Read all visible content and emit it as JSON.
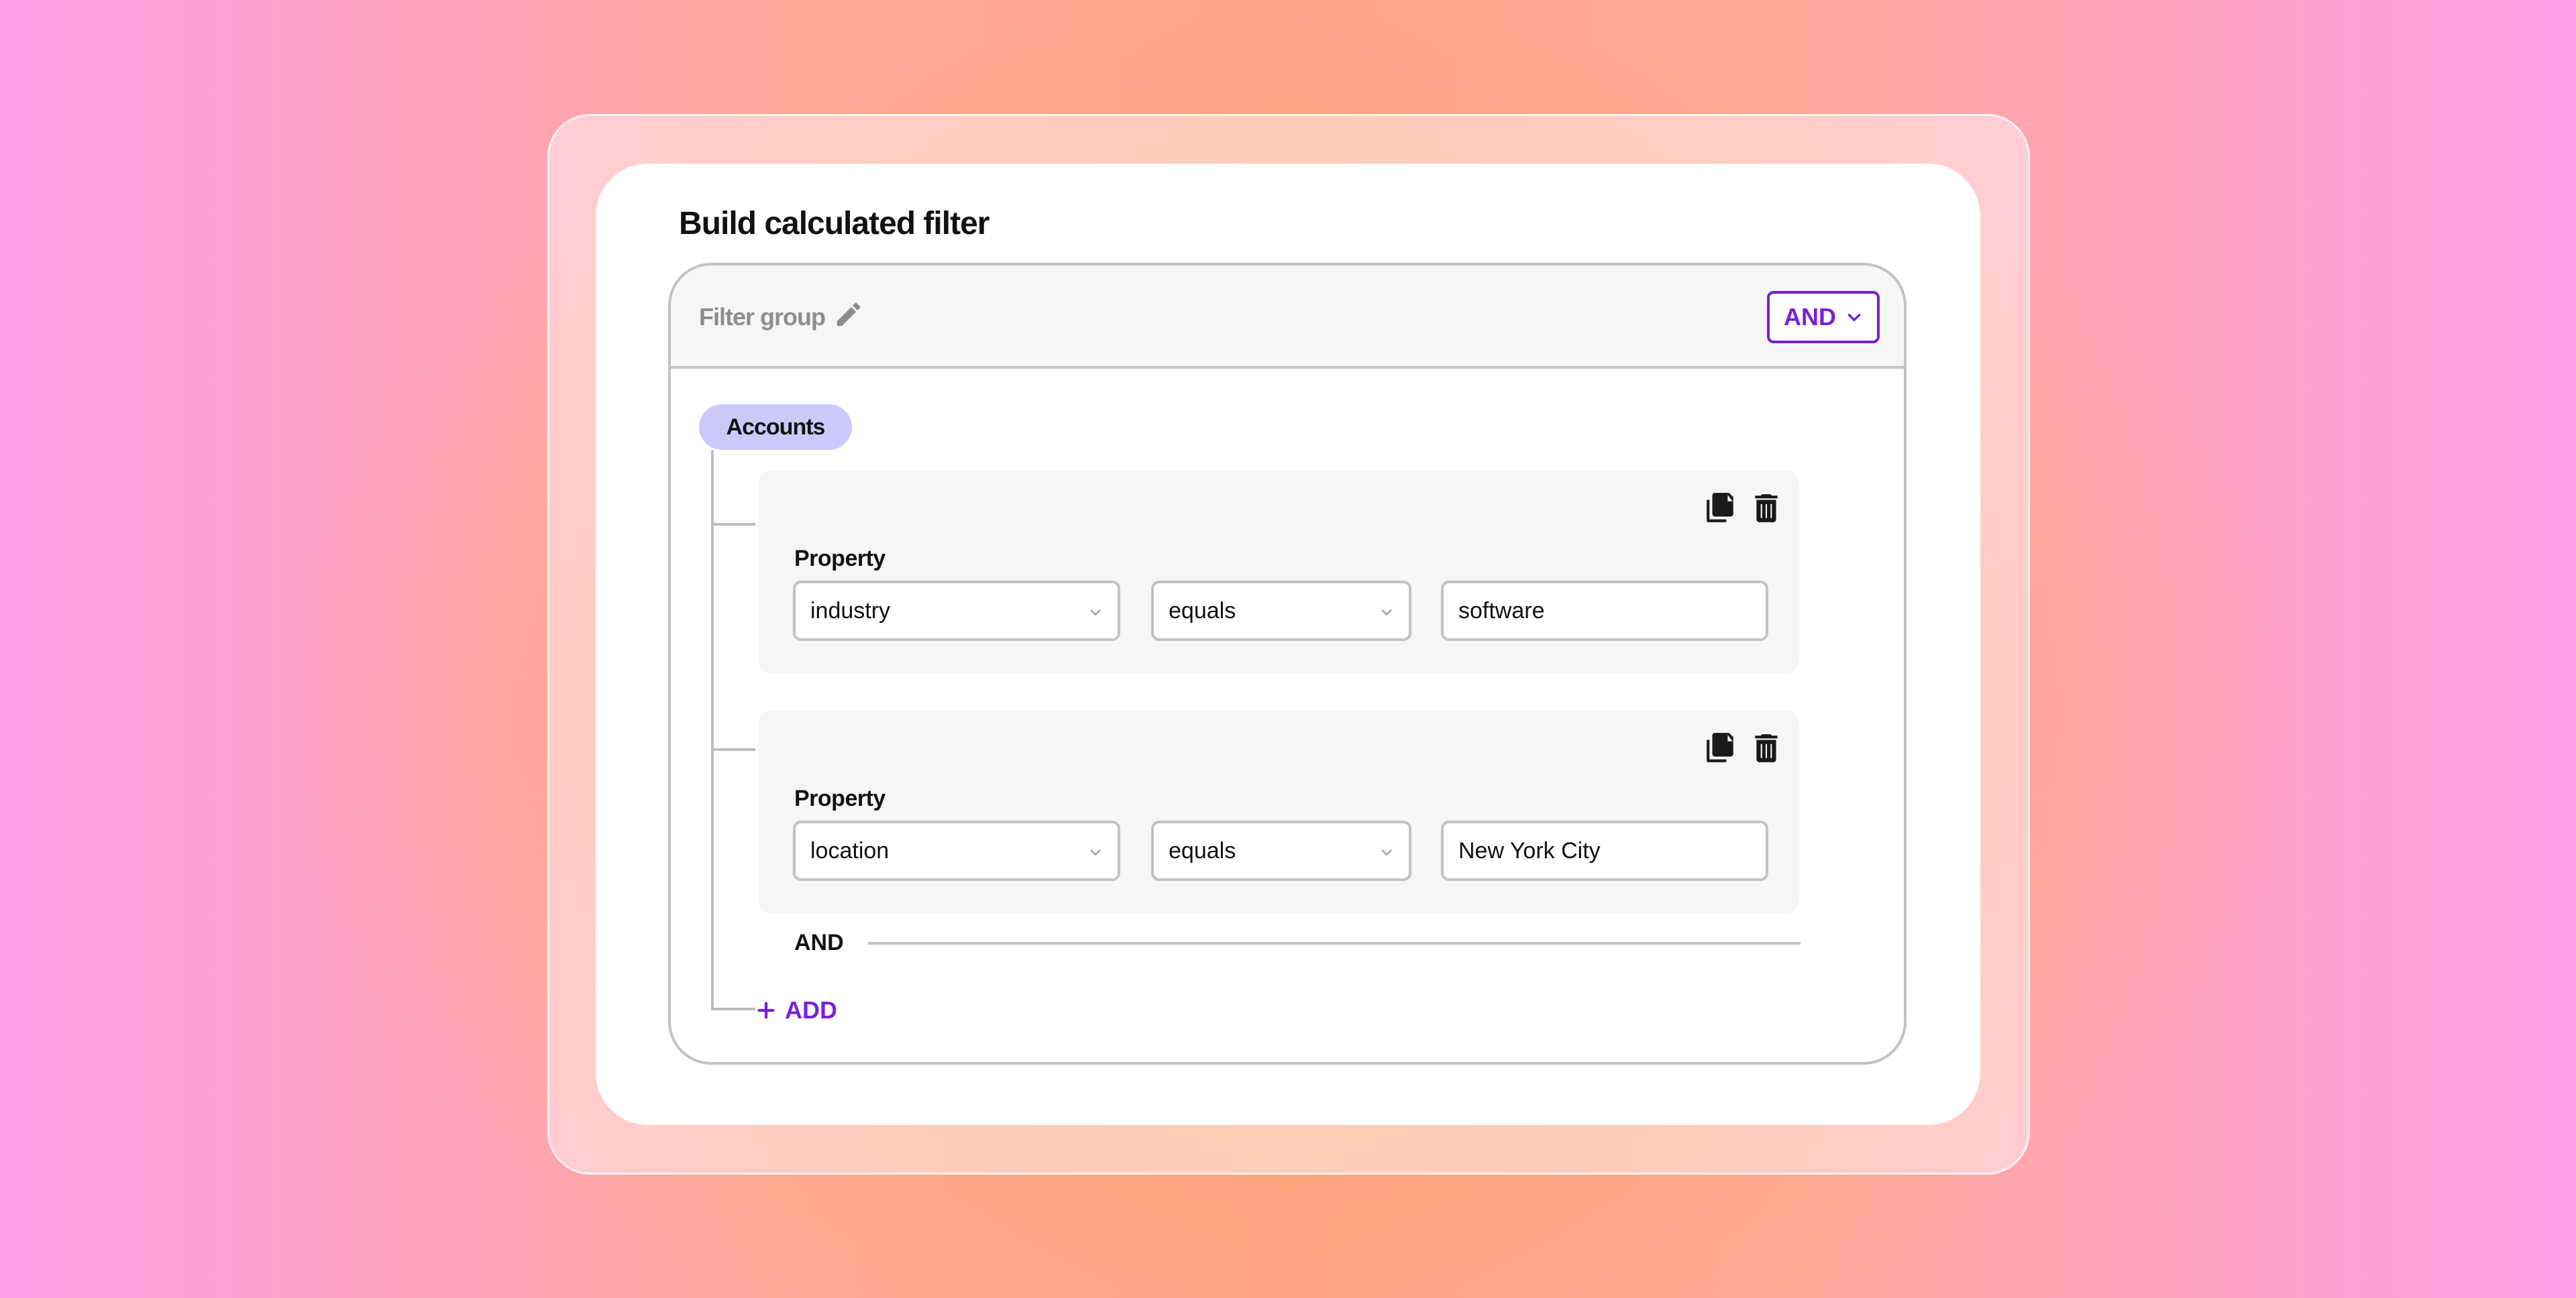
{
  "dialog": {
    "title": "Build calculated filter"
  },
  "filter_group": {
    "name": "Filter group",
    "logic_operator": "AND",
    "edit_icon": "pencil-icon",
    "dropdown_icon": "chevron-down-icon"
  },
  "entity": {
    "label": "Accounts"
  },
  "rules": [
    {
      "label": "Property",
      "property": "industry",
      "operator": "equals",
      "value": "software"
    },
    {
      "label": "Property",
      "property": "location",
      "operator": "equals",
      "value": "New York City"
    }
  ],
  "rule_icons": {
    "copy": "copy-icon",
    "delete": "trash-icon"
  },
  "join_label": "AND",
  "add_button": {
    "icon": "plus-icon",
    "label": "ADD"
  },
  "colors": {
    "accent": "#7a1fd6",
    "entity_pill": "#cccafc",
    "rule_background": "#f6f6f6",
    "border": "#c2c2c2"
  }
}
